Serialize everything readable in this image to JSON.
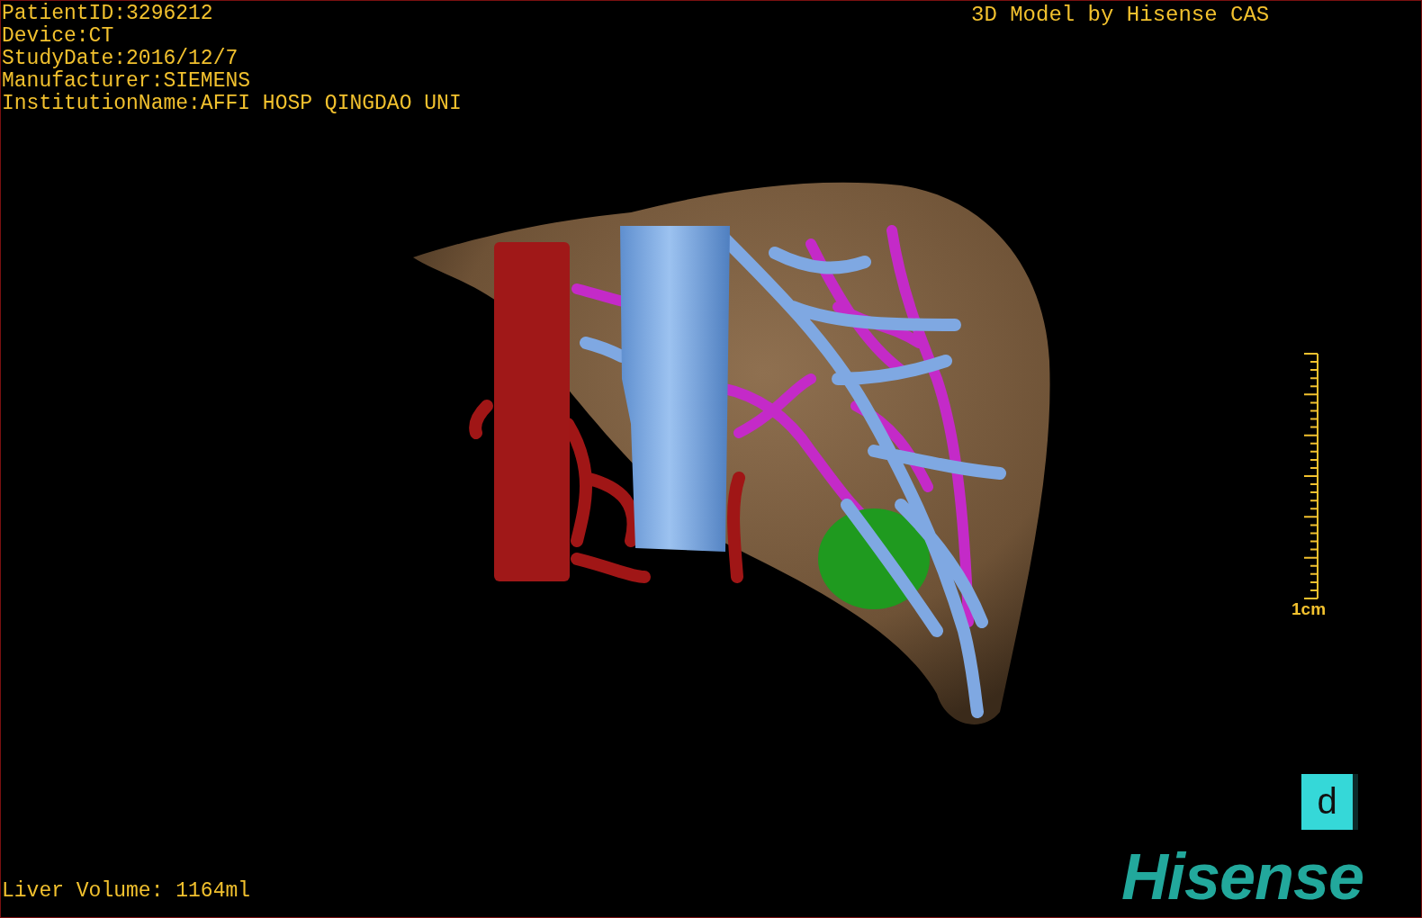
{
  "info_lines": [
    "PatientID:3296212",
    "Device:CT",
    "StudyDate:2016/12/7",
    "Manufacturer:SIEMENS",
    "InstitutionName:AFFI HOSP QINGDAO UNI"
  ],
  "title": "3D Model by Hisense CAS",
  "scale": {
    "label": "1cm"
  },
  "orientation_cube": {
    "label": "d"
  },
  "volume": "Liver Volume: 1164ml",
  "logo": "Hisense"
}
